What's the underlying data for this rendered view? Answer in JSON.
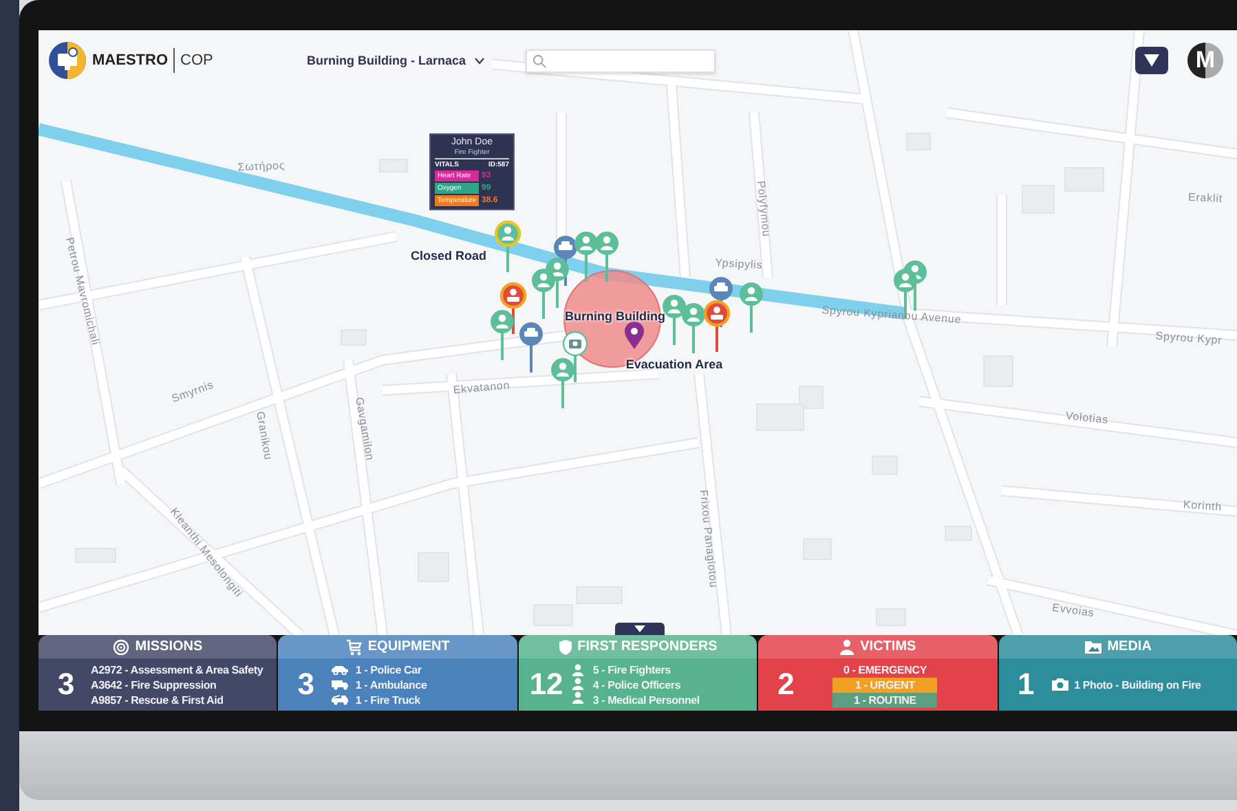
{
  "header": {
    "logo_text": "MAESTRO",
    "product": "COP",
    "incident_select": "Burning Building - Larnaca",
    "avatar_letter": "M"
  },
  "map": {
    "labels": [
      {
        "kind": "street",
        "text": "Σωτήρος"
      },
      {
        "kind": "street",
        "text": "Petrou Mavromichali"
      },
      {
        "kind": "street",
        "text": "Smyrnis"
      },
      {
        "kind": "street",
        "text": "Granikou"
      },
      {
        "kind": "street",
        "text": "Gavgamilon"
      },
      {
        "kind": "street",
        "text": "Ekvatanon"
      },
      {
        "kind": "street",
        "text": "Kleanthi Mesolongiti"
      },
      {
        "kind": "street",
        "text": "Polyfymou"
      },
      {
        "kind": "street",
        "text": "Ypsipylis"
      },
      {
        "kind": "street",
        "text": "Frixou Panagiotou"
      },
      {
        "kind": "street",
        "text": "Spyrou Kyprianou Avenue"
      },
      {
        "kind": "street",
        "text": "Spyrou Kypr"
      },
      {
        "kind": "street",
        "text": "Eraklit"
      },
      {
        "kind": "street",
        "text": "Volotias"
      },
      {
        "kind": "street",
        "text": "Korinth"
      },
      {
        "kind": "street",
        "text": "Evvoias"
      },
      {
        "kind": "annotation",
        "text": "Closed Road"
      },
      {
        "kind": "annotation",
        "text": "Burning Building"
      },
      {
        "kind": "annotation",
        "text": "Evacuation Area"
      }
    ],
    "markers": [
      {
        "kind": "person",
        "highlighted": true
      },
      {
        "kind": "vehicle",
        "highlighted": false
      },
      {
        "kind": "person",
        "highlighted": false
      },
      {
        "kind": "person",
        "highlighted": false
      },
      {
        "kind": "person",
        "highlighted": false
      },
      {
        "kind": "person",
        "highlighted": false
      },
      {
        "kind": "victim",
        "highlighted": false
      },
      {
        "kind": "vehicle",
        "highlighted": false
      },
      {
        "kind": "person",
        "highlighted": false
      },
      {
        "kind": "person",
        "highlighted": false
      },
      {
        "kind": "person",
        "highlighted": false
      },
      {
        "kind": "person",
        "highlighted": false
      },
      {
        "kind": "person",
        "highlighted": false
      },
      {
        "kind": "victim",
        "highlighted": false
      },
      {
        "kind": "person",
        "highlighted": false
      },
      {
        "kind": "vehicle",
        "highlighted": false
      },
      {
        "kind": "location",
        "highlighted": false
      },
      {
        "kind": "camera",
        "highlighted": false
      },
      {
        "kind": "person",
        "highlighted": false
      }
    ]
  },
  "vitals_card": {
    "name": "John Doe",
    "role": "Fire Fighter",
    "section": "VITALS",
    "id": "ID:587",
    "rows": [
      {
        "label": "Heart Rate",
        "value": "93",
        "color": "#d92a9c"
      },
      {
        "label": "Oxygen",
        "value": "99",
        "color": "#2ea586"
      },
      {
        "label": "Temperature",
        "value": "38.6",
        "color": "#ee7a22"
      }
    ]
  },
  "panels": [
    {
      "kind": "missions",
      "title": "MISSIONS",
      "count": "3",
      "color": "#434867",
      "items": [
        {
          "kind": "text",
          "text": "A2972 - Assessment & Area Safety"
        },
        {
          "kind": "text",
          "text": "A3642 - Fire Suppression"
        },
        {
          "kind": "text",
          "text": "A9857 - Rescue & First Aid"
        }
      ]
    },
    {
      "kind": "equipment",
      "title": "EQUIPMENT",
      "count": "3",
      "color": "#4c82bb",
      "items": [
        {
          "kind": "car",
          "text": "1 - Police Car"
        },
        {
          "kind": "ambulance",
          "text": "1 - Ambulance"
        },
        {
          "kind": "truck",
          "text": "1 - Fire Truck"
        }
      ]
    },
    {
      "kind": "responders",
      "title": "FIRST RESPONDERS",
      "count": "12",
      "color": "#56b28f",
      "items": [
        {
          "kind": "text",
          "text": "5 - Fire Fighters"
        },
        {
          "kind": "text",
          "text": "4 - Police Officers"
        },
        {
          "kind": "text",
          "text": "3 - Medical Personnel"
        }
      ]
    },
    {
      "kind": "victims",
      "title": "VICTIMS",
      "count": "2",
      "color": "#e2434a",
      "items": [
        {
          "kind": "level",
          "text": "0 - EMERGENCY"
        },
        {
          "kind": "level",
          "text": "1 - URGENT",
          "color": "#f2a024"
        },
        {
          "kind": "level",
          "text": "1 - ROUTINE",
          "color": "#5c9e82"
        }
      ]
    },
    {
      "kind": "media",
      "title": "MEDIA",
      "count": "1",
      "color": "#2d8d9b",
      "items": [
        {
          "kind": "photo",
          "text": "1 Photo - Building on Fire"
        }
      ]
    }
  ]
}
